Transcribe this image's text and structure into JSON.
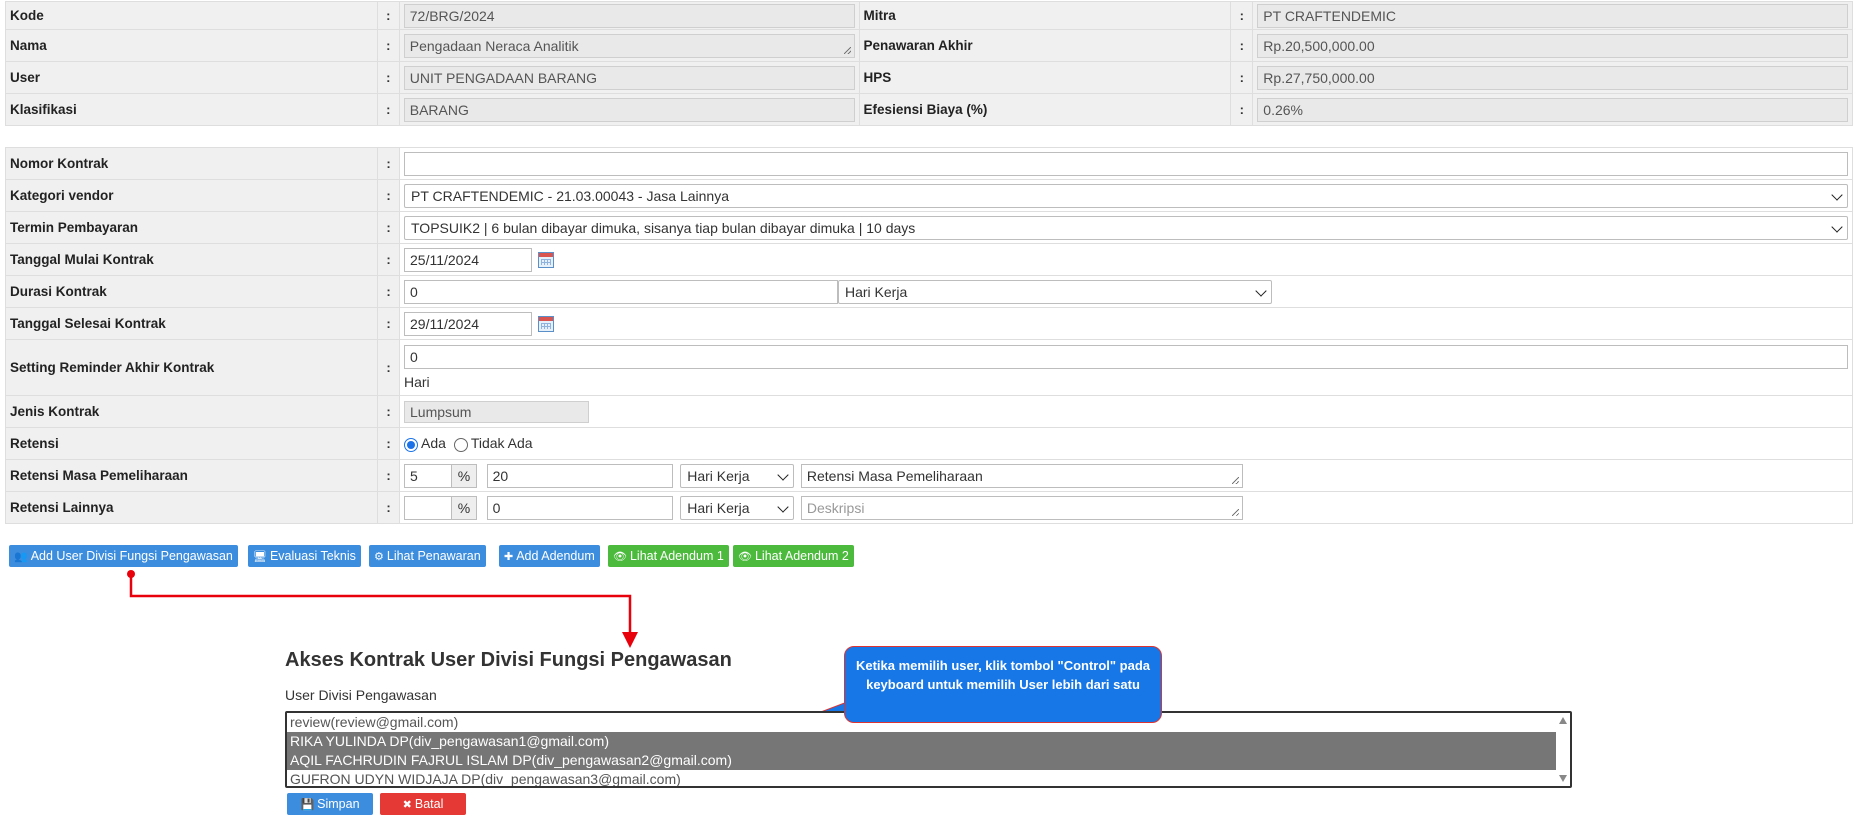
{
  "summary": {
    "kode": {
      "label": "Kode",
      "value": "72/BRG/2024"
    },
    "nama": {
      "label": "Nama",
      "value": "Pengadaan Neraca Analitik"
    },
    "user": {
      "label": "User",
      "value": "UNIT PENGADAAN BARANG"
    },
    "klasifikasi": {
      "label": "Klasifikasi",
      "value": "BARANG"
    },
    "mitra": {
      "label": "Mitra",
      "value": "PT CRAFTENDEMIC"
    },
    "penawaran_akhir": {
      "label": "Penawaran Akhir",
      "value": "Rp.20,500,000.00"
    },
    "hps": {
      "label": "HPS",
      "value": "Rp.27,750,000.00"
    },
    "efisiensi": {
      "label": "Efesiensi Biaya (%)",
      "value": "0.26%"
    }
  },
  "colon": ":",
  "form": {
    "nomor_kontrak": {
      "label": "Nomor Kontrak",
      "value": ""
    },
    "kategori_vendor": {
      "label": "Kategori vendor",
      "value": "PT CRAFTENDEMIC - 21.03.00043 - Jasa Lainnya"
    },
    "termin": {
      "label": "Termin Pembayaran",
      "value": "TOPSUIK2 | 6 bulan dibayar dimuka, sisanya tiap bulan dibayar dimuka | 10 days"
    },
    "tgl_mulai": {
      "label": "Tanggal Mulai Kontrak",
      "value": "25/11/2024"
    },
    "durasi": {
      "label": "Durasi Kontrak",
      "value": "0",
      "unit": "Hari Kerja"
    },
    "tgl_selesai": {
      "label": "Tanggal Selesai Kontrak",
      "value": "29/11/2024"
    },
    "reminder": {
      "label": "Setting Reminder Akhir Kontrak",
      "value": "0",
      "unit": "Hari"
    },
    "jenis": {
      "label": "Jenis Kontrak",
      "value": "Lumpsum"
    },
    "retensi": {
      "label": "Retensi",
      "option_ada": "Ada",
      "option_tidak": "Tidak Ada",
      "selected": "Ada"
    },
    "retensi_pemeliharaan": {
      "label": "Retensi Masa Pemeliharaan",
      "percent": "5",
      "percent_sign": "%",
      "days": "20",
      "unit": "Hari Kerja",
      "desc": "Retensi Masa Pemeliharaan"
    },
    "retensi_lainnya": {
      "label": "Retensi Lainnya",
      "percent": "",
      "percent_sign": "%",
      "days": "0",
      "unit": "Hari Kerja",
      "desc_placeholder": "Deskripsi"
    }
  },
  "buttons": {
    "add_user": "Add User Divisi Fungsi Pengawasan",
    "evaluasi": "Evaluasi Teknis",
    "lihat_penawaran": "Lihat Penawaran",
    "add_adendum": "Add Adendum",
    "adendum1": "Lihat Adendum 1",
    "adendum2": "Lihat Adendum 2"
  },
  "akses": {
    "title": "Akses Kontrak User Divisi Fungsi Pengawasan",
    "list_label": "User Divisi Pengawasan",
    "options": [
      {
        "text": "review(review@gmail.com)",
        "selected": false
      },
      {
        "text": "RIKA YULINDA DP(div_pengawasan1@gmail.com)",
        "selected": true
      },
      {
        "text": "AQIL FACHRUDIN FAJRUL ISLAM DP(div_pengawasan2@gmail.com)",
        "selected": true
      },
      {
        "text": "GUFRON UDYN WIDJAJA DP(div_pengawasan3@gmail.com)",
        "selected": false
      }
    ],
    "simpan": "Simpan",
    "batal": "Batal"
  },
  "callout": "Ketika memilih user, klik tombol \"Control\" pada keyboard untuk memilih User lebih dari satu",
  "colors": {
    "primary": "#3c8dde",
    "success": "#4cbb3d",
    "danger": "#e53935",
    "annotation": "#e8000b"
  },
  "icons": [
    "users-icon",
    "monitor-icon",
    "gears-icon",
    "plus-icon",
    "eye-icon",
    "save-icon",
    "times-icon",
    "calendar-icon"
  ]
}
